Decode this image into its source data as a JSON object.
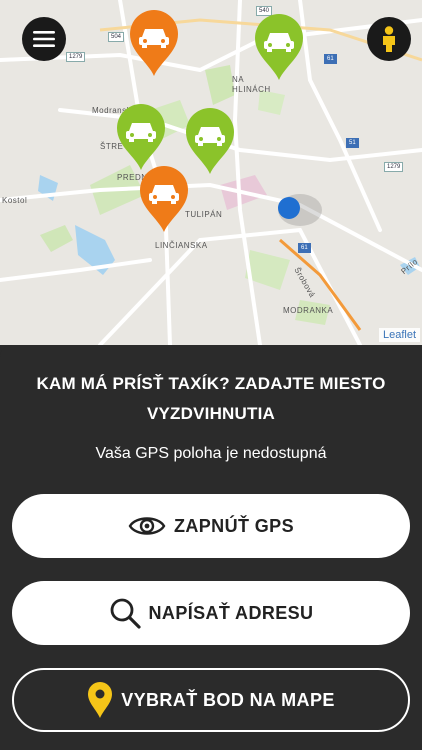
{
  "map": {
    "labels": {
      "na_hlinach": "NA\nHLINÁCH",
      "modranska": "Modranská",
      "strelnica": "ŠTRE",
      "prednadrazie": "PREDNA",
      "tulipan": "TULIPÁN",
      "linchianska": "LINČIANSKA",
      "kostol": "Kostol",
      "modranka": "MODRANKA",
      "serbska": "Šrobová",
      "prilo": "Prílo"
    },
    "road_tags": {
      "r1279a": "1279",
      "r504": "504",
      "r540": "540",
      "r61a": "61",
      "r51": "51",
      "r1279b": "1279",
      "r61b": "61"
    },
    "attribution": "Leaflet",
    "pin_colors": {
      "orange": "#ef7b18",
      "green": "#8bc32a"
    }
  },
  "panel": {
    "title": "KAM MÁ PRÍSŤ TAXÍK? ZADAJTE MIESTO VYZDVIHNUTIA",
    "gps_status": "Vaša GPS poloha je nedostupná",
    "buttons": {
      "enable_gps": "ZAPNÚŤ GPS",
      "type_address": "NAPÍSAŤ ADRESU",
      "pick_on_map": "VYBRAŤ BOD NA MAPE"
    }
  },
  "colors": {
    "accent": "#f5c518",
    "panel_bg": "#2b2b2b",
    "user_dot": "#1f6fd1"
  }
}
